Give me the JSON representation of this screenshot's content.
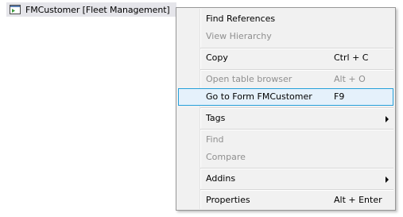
{
  "tree": {
    "node_label": "FMCustomer [Fleet Management]",
    "icon": "form-icon"
  },
  "menu": {
    "items": {
      "find_references": {
        "label": "Find References"
      },
      "view_hierarchy": {
        "label": "View Hierarchy"
      },
      "copy": {
        "label": "Copy",
        "shortcut": "Ctrl + C"
      },
      "open_table_browser": {
        "label": "Open table browser",
        "shortcut": "Alt + O"
      },
      "go_to_form": {
        "label": "Go to Form FMCustomer",
        "shortcut": "F9"
      },
      "tags": {
        "label": "Tags"
      },
      "find": {
        "label": "Find"
      },
      "compare": {
        "label": "Compare"
      },
      "addins": {
        "label": "Addins"
      },
      "properties": {
        "label": "Properties",
        "shortcut": "Alt + Enter"
      }
    }
  },
  "colors": {
    "menu_background": "#f1f1f1",
    "highlight_background": "#e5f1fb",
    "highlight_border": "#26a0da",
    "disabled_text": "#8f8f8f"
  }
}
